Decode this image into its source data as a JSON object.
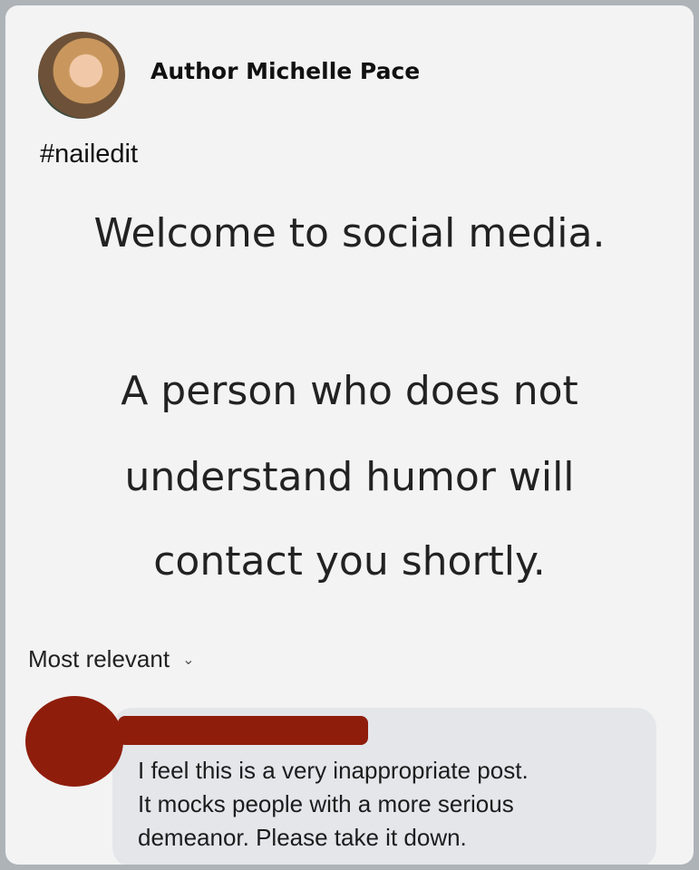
{
  "post": {
    "author": "Author Michelle Pace",
    "hashtag": "#nailedit",
    "headline": "Welcome to social media.",
    "body_lines": [
      "A person who does not",
      "understand humor will",
      "contact you shortly."
    ]
  },
  "comments": {
    "sort_label": "Most relevant",
    "items": [
      {
        "text_lines": [
          "I feel this is a very inappropriate post.",
          "It mocks people with a more serious",
          "demeanor. Please take it down."
        ]
      }
    ]
  },
  "icons": {
    "sort": "chevron-down-icon"
  },
  "colors": {
    "redaction": "#8f1d0c",
    "comment_bubble": "#e4e6ea"
  }
}
